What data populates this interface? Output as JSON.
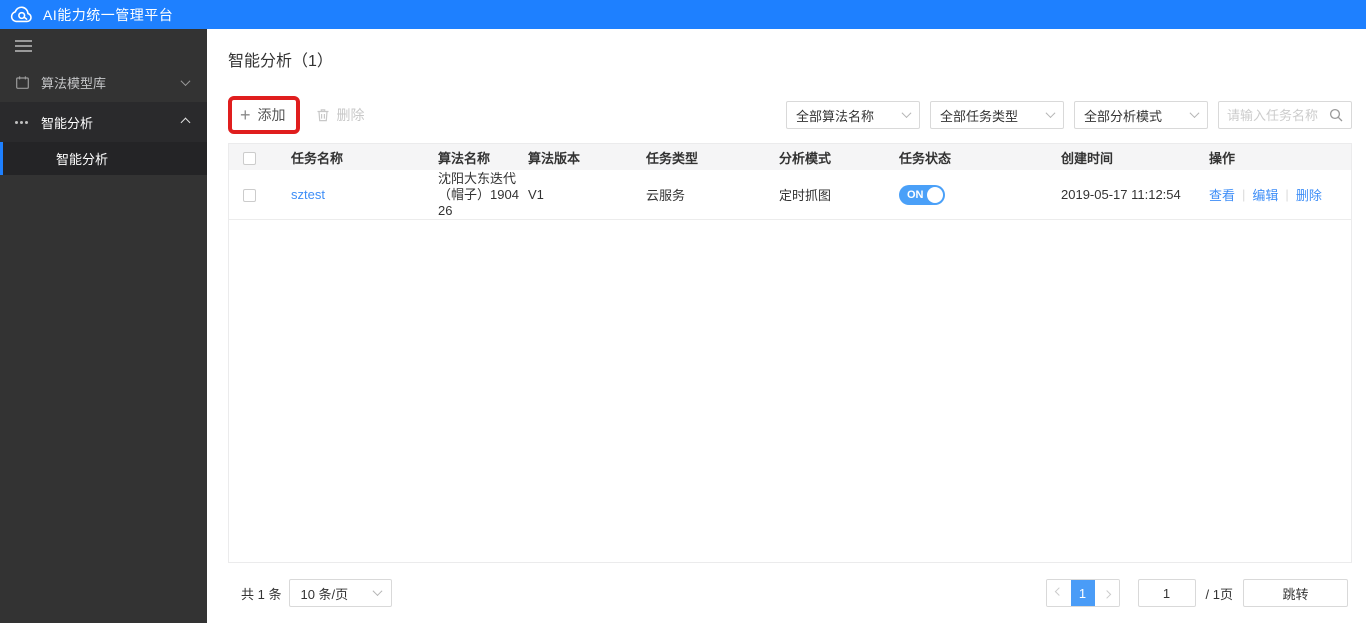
{
  "app": {
    "title": "AI能力统一管理平台"
  },
  "sidebar": {
    "items": [
      {
        "label": "算法模型库",
        "icon": "calendar-icon",
        "expanded": false
      },
      {
        "label": "智能分析",
        "icon": "dots-icon",
        "expanded": true,
        "children": [
          {
            "label": "智能分析",
            "active": true
          }
        ]
      }
    ]
  },
  "page": {
    "title": "智能分析（1）",
    "toolbar": {
      "add_label": "添加",
      "delete_label": "删除",
      "filters": [
        "全部算法名称",
        "全部任务类型",
        "全部分析模式"
      ],
      "search_placeholder": "请输入任务名称"
    },
    "table": {
      "columns": [
        "任务名称",
        "算法名称",
        "算法版本",
        "任务类型",
        "分析模式",
        "任务状态",
        "创建时间",
        "操作"
      ],
      "rows": [
        {
          "task_name": "sztest",
          "algorithm_name": "沈阳大东迭代（帽子）190426",
          "algorithm_version": "V1",
          "task_type": "云服务",
          "analysis_mode": "定时抓图",
          "status": "ON",
          "created_at": "2019-05-17 11:12:54",
          "actions": [
            "查看",
            "编辑",
            "删除"
          ]
        }
      ]
    },
    "pagination": {
      "total": "共 1 条",
      "page_size": "10 条/页",
      "current_page": "1",
      "page_input": "1",
      "page_total": "/ 1页",
      "jump": "跳转"
    }
  },
  "icons": {
    "logo": "cloud-icon",
    "sidebar_collapse": "menu-icon",
    "menu_library": "calendar-icon",
    "menu_analysis": "dots-icon",
    "add": "plus-icon",
    "delete": "trash-icon",
    "search": "search-icon",
    "dropdown": "chevron-down-icon"
  },
  "colors": {
    "brand_blue": "#1E80FF",
    "toggle_on_blue": "#4AA0F8",
    "active_page_blue": "#4A9CF7",
    "link_blue": "#3E8EF7",
    "annotation_red": "#E01E1E",
    "sidebar_bg": "#333333",
    "table_header_bg": "#F5F5F6"
  }
}
